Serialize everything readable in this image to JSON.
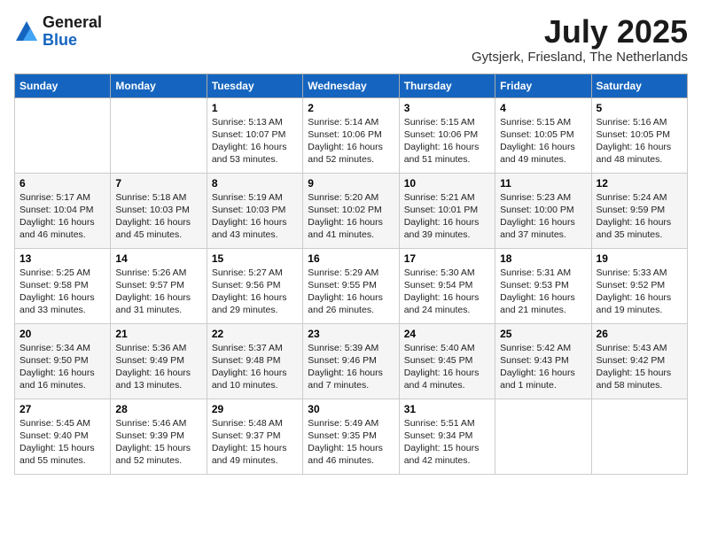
{
  "logo": {
    "general": "General",
    "blue": "Blue"
  },
  "title": {
    "month": "July 2025",
    "location": "Gytsjerk, Friesland, The Netherlands"
  },
  "headers": [
    "Sunday",
    "Monday",
    "Tuesday",
    "Wednesday",
    "Thursday",
    "Friday",
    "Saturday"
  ],
  "weeks": [
    [
      {
        "day": "",
        "info": ""
      },
      {
        "day": "",
        "info": ""
      },
      {
        "day": "1",
        "info": "Sunrise: 5:13 AM\nSunset: 10:07 PM\nDaylight: 16 hours and 53 minutes."
      },
      {
        "day": "2",
        "info": "Sunrise: 5:14 AM\nSunset: 10:06 PM\nDaylight: 16 hours and 52 minutes."
      },
      {
        "day": "3",
        "info": "Sunrise: 5:15 AM\nSunset: 10:06 PM\nDaylight: 16 hours and 51 minutes."
      },
      {
        "day": "4",
        "info": "Sunrise: 5:15 AM\nSunset: 10:05 PM\nDaylight: 16 hours and 49 minutes."
      },
      {
        "day": "5",
        "info": "Sunrise: 5:16 AM\nSunset: 10:05 PM\nDaylight: 16 hours and 48 minutes."
      }
    ],
    [
      {
        "day": "6",
        "info": "Sunrise: 5:17 AM\nSunset: 10:04 PM\nDaylight: 16 hours and 46 minutes."
      },
      {
        "day": "7",
        "info": "Sunrise: 5:18 AM\nSunset: 10:03 PM\nDaylight: 16 hours and 45 minutes."
      },
      {
        "day": "8",
        "info": "Sunrise: 5:19 AM\nSunset: 10:03 PM\nDaylight: 16 hours and 43 minutes."
      },
      {
        "day": "9",
        "info": "Sunrise: 5:20 AM\nSunset: 10:02 PM\nDaylight: 16 hours and 41 minutes."
      },
      {
        "day": "10",
        "info": "Sunrise: 5:21 AM\nSunset: 10:01 PM\nDaylight: 16 hours and 39 minutes."
      },
      {
        "day": "11",
        "info": "Sunrise: 5:23 AM\nSunset: 10:00 PM\nDaylight: 16 hours and 37 minutes."
      },
      {
        "day": "12",
        "info": "Sunrise: 5:24 AM\nSunset: 9:59 PM\nDaylight: 16 hours and 35 minutes."
      }
    ],
    [
      {
        "day": "13",
        "info": "Sunrise: 5:25 AM\nSunset: 9:58 PM\nDaylight: 16 hours and 33 minutes."
      },
      {
        "day": "14",
        "info": "Sunrise: 5:26 AM\nSunset: 9:57 PM\nDaylight: 16 hours and 31 minutes."
      },
      {
        "day": "15",
        "info": "Sunrise: 5:27 AM\nSunset: 9:56 PM\nDaylight: 16 hours and 29 minutes."
      },
      {
        "day": "16",
        "info": "Sunrise: 5:29 AM\nSunset: 9:55 PM\nDaylight: 16 hours and 26 minutes."
      },
      {
        "day": "17",
        "info": "Sunrise: 5:30 AM\nSunset: 9:54 PM\nDaylight: 16 hours and 24 minutes."
      },
      {
        "day": "18",
        "info": "Sunrise: 5:31 AM\nSunset: 9:53 PM\nDaylight: 16 hours and 21 minutes."
      },
      {
        "day": "19",
        "info": "Sunrise: 5:33 AM\nSunset: 9:52 PM\nDaylight: 16 hours and 19 minutes."
      }
    ],
    [
      {
        "day": "20",
        "info": "Sunrise: 5:34 AM\nSunset: 9:50 PM\nDaylight: 16 hours and 16 minutes."
      },
      {
        "day": "21",
        "info": "Sunrise: 5:36 AM\nSunset: 9:49 PM\nDaylight: 16 hours and 13 minutes."
      },
      {
        "day": "22",
        "info": "Sunrise: 5:37 AM\nSunset: 9:48 PM\nDaylight: 16 hours and 10 minutes."
      },
      {
        "day": "23",
        "info": "Sunrise: 5:39 AM\nSunset: 9:46 PM\nDaylight: 16 hours and 7 minutes."
      },
      {
        "day": "24",
        "info": "Sunrise: 5:40 AM\nSunset: 9:45 PM\nDaylight: 16 hours and 4 minutes."
      },
      {
        "day": "25",
        "info": "Sunrise: 5:42 AM\nSunset: 9:43 PM\nDaylight: 16 hours and 1 minute."
      },
      {
        "day": "26",
        "info": "Sunrise: 5:43 AM\nSunset: 9:42 PM\nDaylight: 15 hours and 58 minutes."
      }
    ],
    [
      {
        "day": "27",
        "info": "Sunrise: 5:45 AM\nSunset: 9:40 PM\nDaylight: 15 hours and 55 minutes."
      },
      {
        "day": "28",
        "info": "Sunrise: 5:46 AM\nSunset: 9:39 PM\nDaylight: 15 hours and 52 minutes."
      },
      {
        "day": "29",
        "info": "Sunrise: 5:48 AM\nSunset: 9:37 PM\nDaylight: 15 hours and 49 minutes."
      },
      {
        "day": "30",
        "info": "Sunrise: 5:49 AM\nSunset: 9:35 PM\nDaylight: 15 hours and 46 minutes."
      },
      {
        "day": "31",
        "info": "Sunrise: 5:51 AM\nSunset: 9:34 PM\nDaylight: 15 hours and 42 minutes."
      },
      {
        "day": "",
        "info": ""
      },
      {
        "day": "",
        "info": ""
      }
    ]
  ]
}
